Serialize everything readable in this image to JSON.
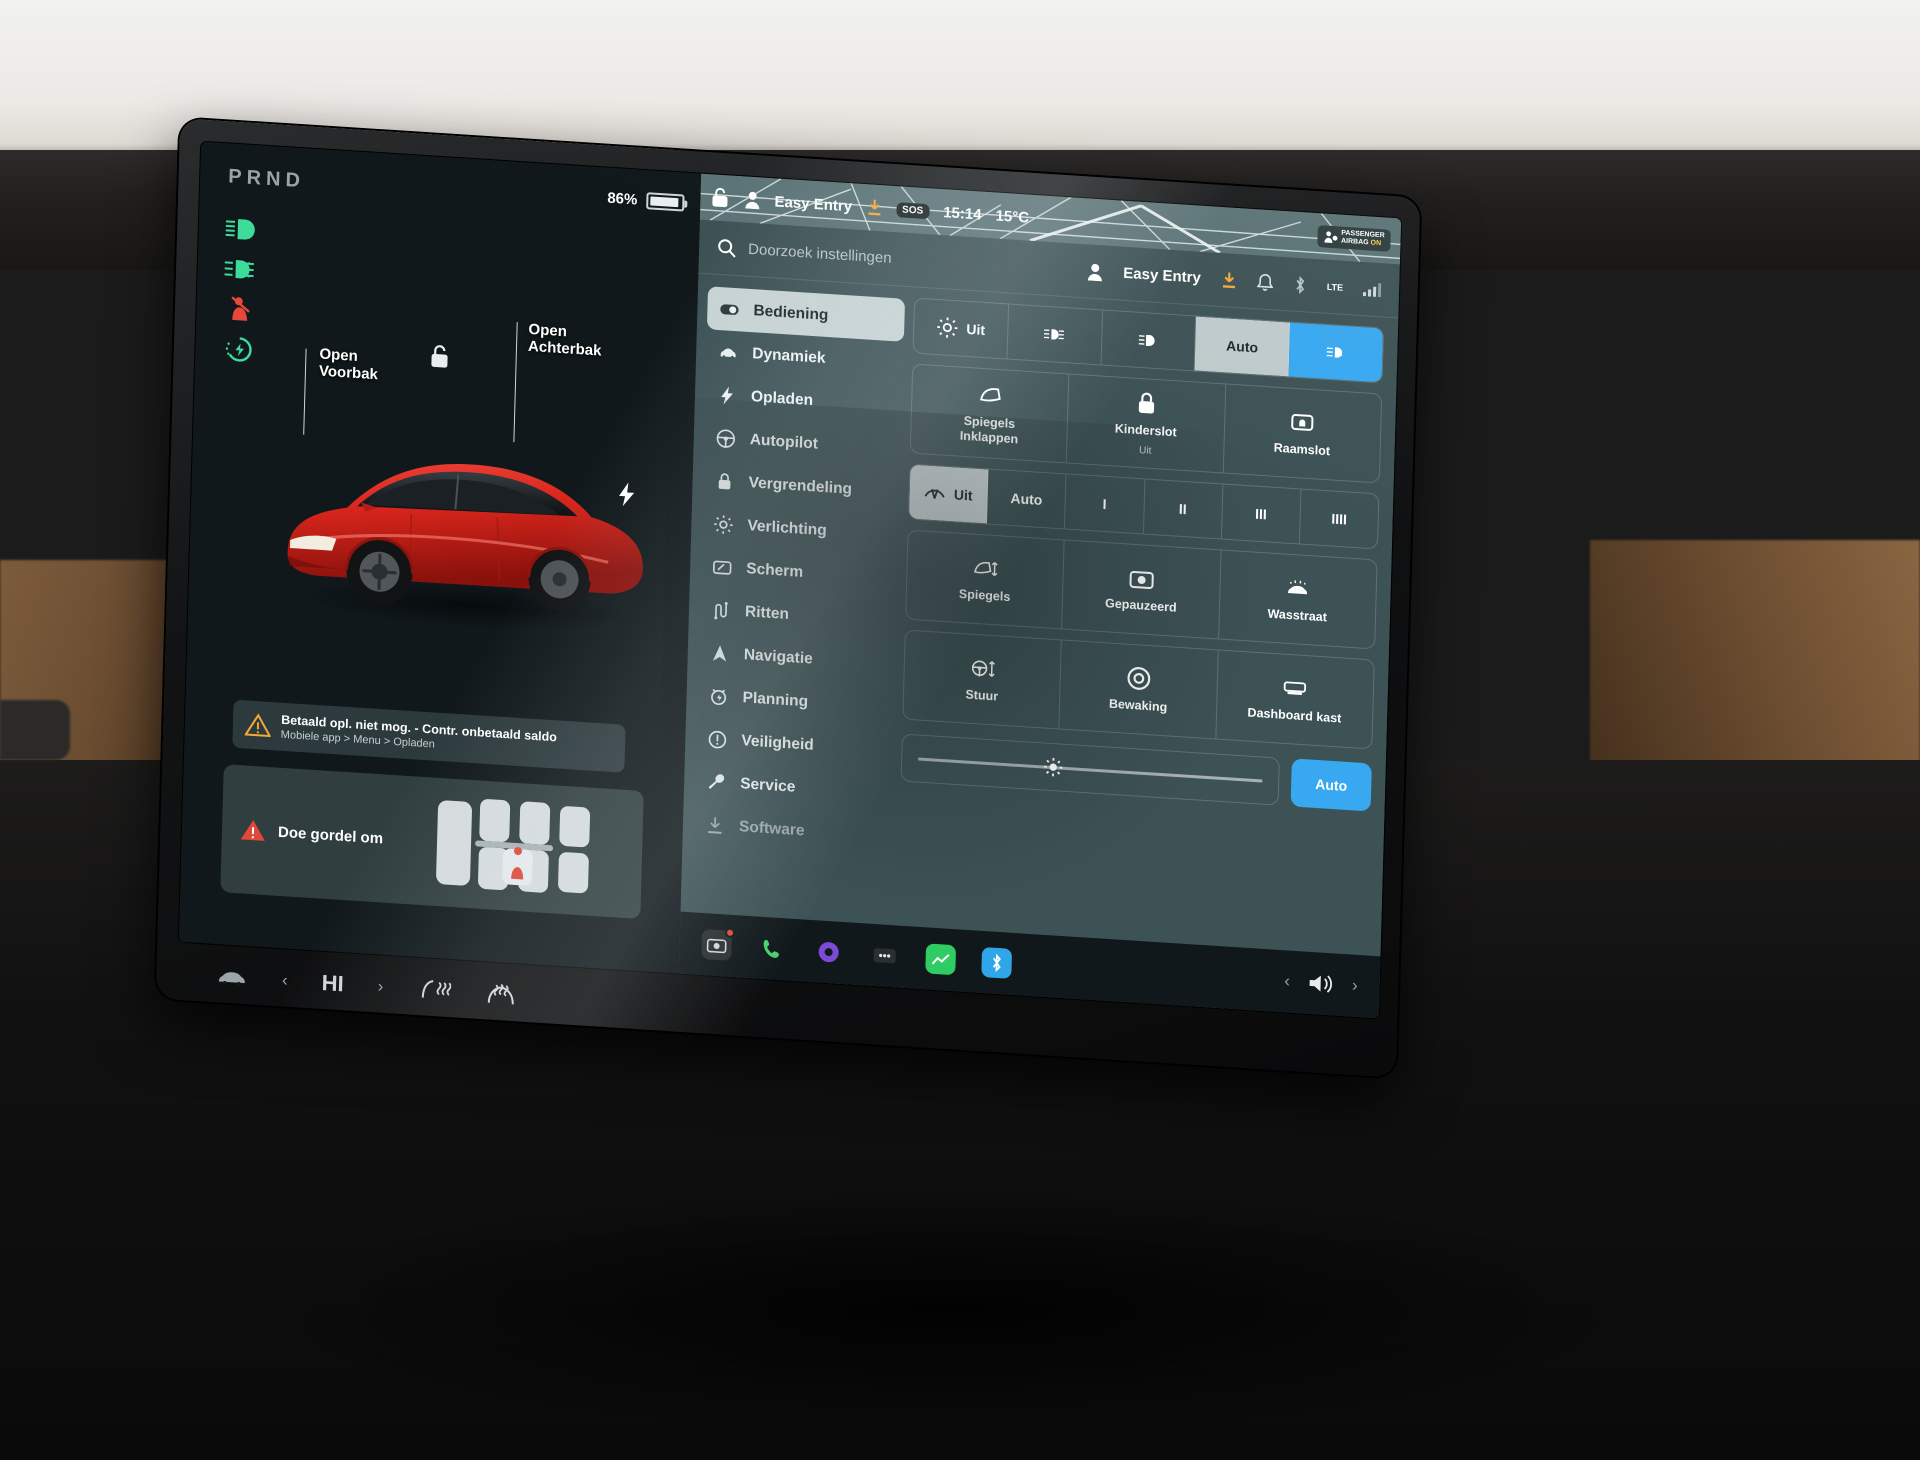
{
  "status_bar": {
    "gear": "PRND",
    "gear_active": "D",
    "battery_percent": "86%",
    "profile": "Easy Entry",
    "sos_label": "SOS",
    "time": "15:14",
    "temperature": "15°C",
    "airbag_line1": "PASSENGER",
    "airbag_line2": "AIRBAG",
    "airbag_status": "ON",
    "network_label": "LTE"
  },
  "car_panel": {
    "label_frunk_line1": "Open",
    "label_frunk_line2": "Voorbak",
    "label_trunk_line1": "Open",
    "label_trunk_line2": "Achterbak",
    "charge_warning_title": "Betaald opl. niet mog. - Contr. onbetaald saldo",
    "charge_warning_sub": "Mobiele app > Menu > Opladen",
    "seatbelt_warning": "Doe gordel om"
  },
  "search": {
    "placeholder": "Doorzoek instellingen"
  },
  "menu": {
    "items": [
      {
        "label": "Bediening",
        "icon": "toggle-icon",
        "selected": true
      },
      {
        "label": "Dynamiek",
        "icon": "car-icon",
        "selected": false
      },
      {
        "label": "Opladen",
        "icon": "bolt-icon",
        "selected": false
      },
      {
        "label": "Autopilot",
        "icon": "steering-wheel-icon",
        "selected": false
      },
      {
        "label": "Vergrendeling",
        "icon": "lock-icon",
        "selected": false
      },
      {
        "label": "Verlichting",
        "icon": "sun-icon",
        "selected": false
      },
      {
        "label": "Scherm",
        "icon": "display-icon",
        "selected": false
      },
      {
        "label": "Ritten",
        "icon": "route-icon",
        "selected": false
      },
      {
        "label": "Navigatie",
        "icon": "navigation-arrow-icon",
        "selected": false
      },
      {
        "label": "Planning",
        "icon": "alarm-icon",
        "selected": false
      },
      {
        "label": "Veiligheid",
        "icon": "warning-circle-icon",
        "selected": false
      },
      {
        "label": "Service",
        "icon": "wrench-icon",
        "selected": false
      },
      {
        "label": "Software",
        "icon": "download-icon",
        "selected": false
      }
    ]
  },
  "controls": {
    "lights_row": [
      {
        "label": "Uit",
        "icon": "sun-icon",
        "state": "off"
      },
      {
        "label": "",
        "icon": "low-beam-icon",
        "state": "off"
      },
      {
        "label": "",
        "icon": "headlight-icon",
        "state": "off"
      },
      {
        "label": "Auto",
        "icon": "",
        "state": "active"
      },
      {
        "label": "",
        "icon": "auto-highbeam-icon",
        "state": "blue"
      }
    ],
    "lock_tiles": [
      {
        "label": "Spiegels\nInklappen",
        "sub": "",
        "icon": "mirror-icon"
      },
      {
        "label": "Kinderslot",
        "sub": "Uit",
        "icon": "child-lock-icon"
      },
      {
        "label": "Raamslot",
        "sub": "",
        "icon": "window-lock-icon"
      }
    ],
    "wiper_row": [
      {
        "label": "Uit",
        "icon": "wiper-icon",
        "state": "active"
      },
      {
        "label": "Auto",
        "icon": "",
        "state": "off"
      },
      {
        "label": "I",
        "icon": "",
        "state": "off"
      },
      {
        "label": "II",
        "icon": "",
        "state": "off"
      },
      {
        "label": "III",
        "icon": "",
        "state": "off"
      },
      {
        "label": "IIII",
        "icon": "",
        "state": "off"
      }
    ],
    "tiles_row_1": [
      {
        "label": "Spiegels",
        "icon": "mirror-adjust-icon"
      },
      {
        "label": "Gepauzeerd",
        "icon": "camera-icon"
      },
      {
        "label": "Wasstraat",
        "icon": "carwash-icon"
      }
    ],
    "tiles_row_2": [
      {
        "label": "Stuur",
        "icon": "steering-adjust-icon"
      },
      {
        "label": "Bewaking",
        "icon": "sentry-icon"
      },
      {
        "label": "Dashboard kast",
        "icon": "glovebox-icon"
      }
    ],
    "brightness_auto_label": "Auto"
  },
  "colors": {
    "accent_blue": "#38a8f0",
    "panel_bg": "#3d5255",
    "screen_bg": "#10181b",
    "warning_red": "#e04a3a",
    "tell_green": "#3ddc9a",
    "amber": "#f0a93a"
  }
}
